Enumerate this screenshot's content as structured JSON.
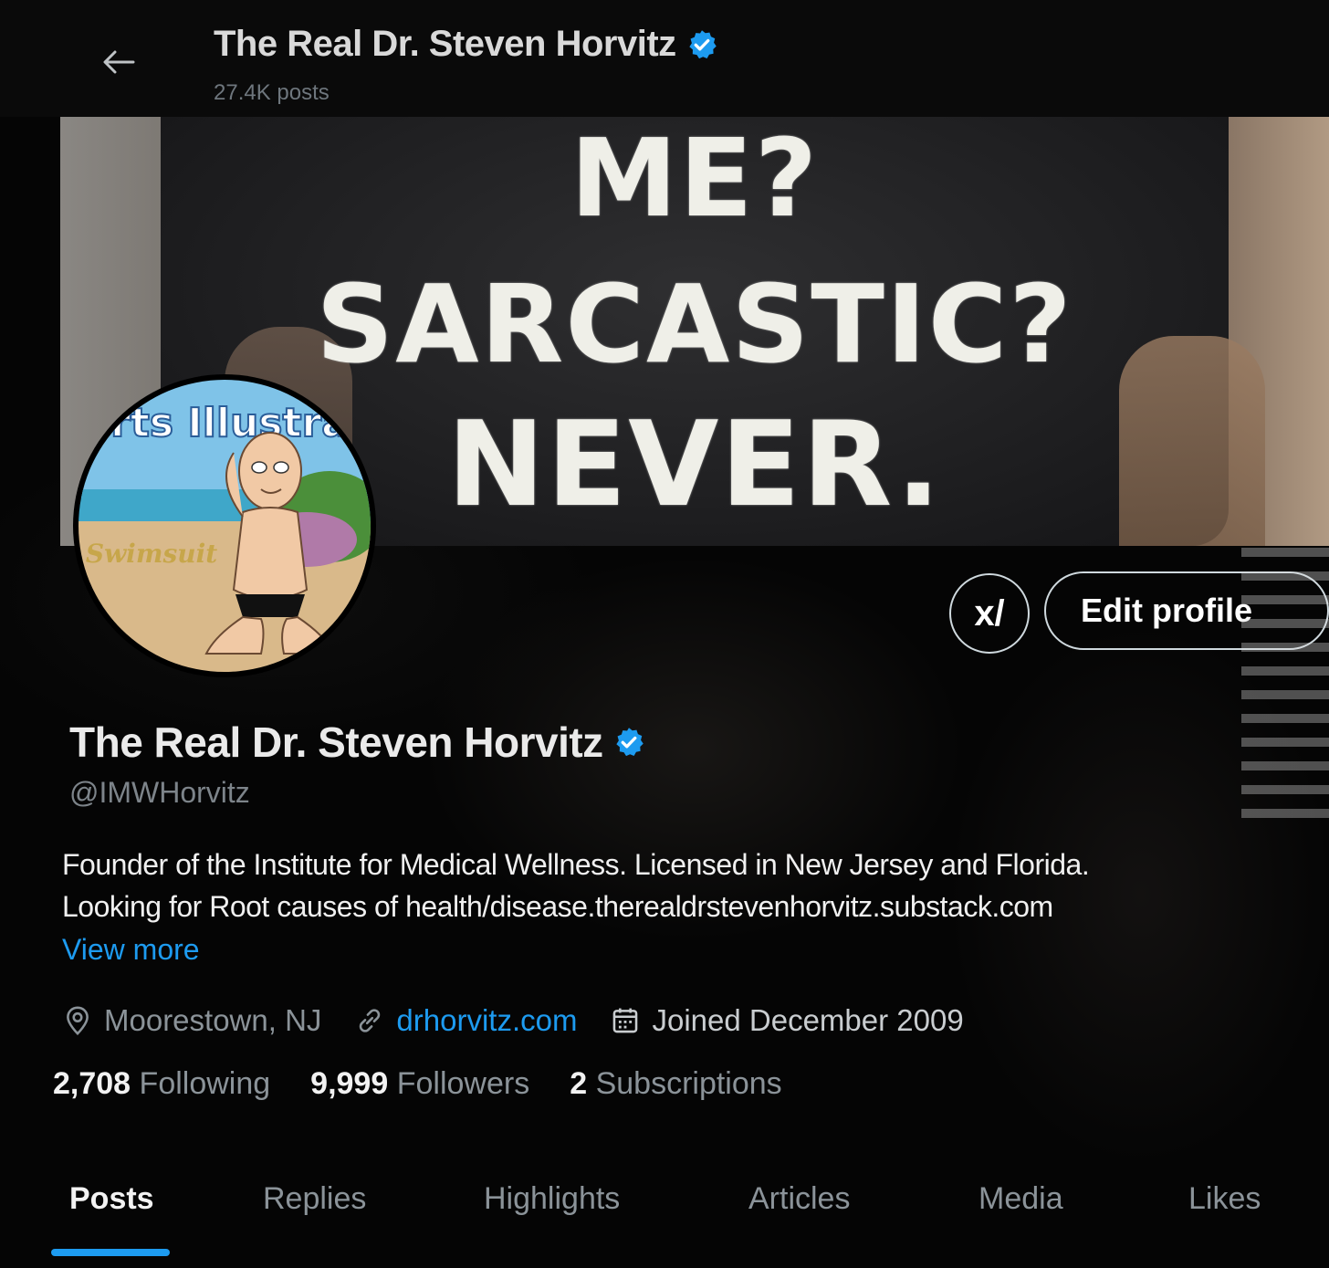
{
  "header": {
    "title": "The Real Dr. Steven Horvitz",
    "posts_count": "27.4K posts"
  },
  "banner": {
    "line1": "ME?",
    "line2": "SARCASTIC?",
    "line3": "NEVER."
  },
  "actions": {
    "grok_label": "x/",
    "edit_profile": "Edit profile"
  },
  "profile": {
    "name": "The Real Dr. Steven Horvitz",
    "handle": "@IMWHorvitz",
    "bio_line1": "Founder of the Institute for Medical Wellness. Licensed in New Jersey and Florida.",
    "bio_line2": "Looking for Root causes of health/disease.therealdrstevenhorvitz.substack.com",
    "view_more": "View more",
    "location": "Moorestown, NJ",
    "website": "drhorvitz.com",
    "joined": "Joined December 2009",
    "avatar_text_top": "Sports Illustrated",
    "avatar_text_mid": "Swimsuit"
  },
  "stats": {
    "following_count": "2,708",
    "following_label": "Following",
    "followers_count": "9,999",
    "followers_label": "Followers",
    "subscriptions_count": "2",
    "subscriptions_label": "Subscriptions"
  },
  "tabs": [
    {
      "label": "Posts",
      "active": true
    },
    {
      "label": "Replies"
    },
    {
      "label": "Highlights"
    },
    {
      "label": "Articles"
    },
    {
      "label": "Media"
    },
    {
      "label": "Likes"
    }
  ],
  "colors": {
    "accent": "#1d9bf0",
    "background": "#050505",
    "muted": "#8b9399"
  }
}
